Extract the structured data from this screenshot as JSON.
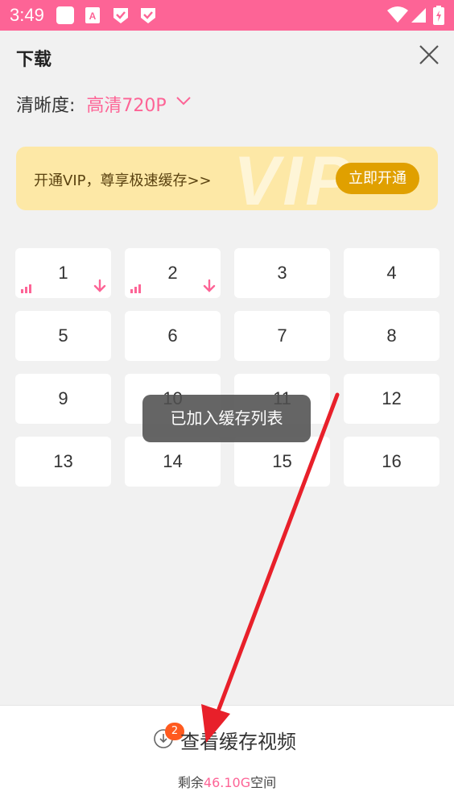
{
  "status_bar": {
    "time": "3:49",
    "left_icons": [
      "notification-square-icon",
      "app-a-icon",
      "shield-check-icon",
      "shield-check-icon"
    ],
    "right_icons": [
      "wifi-icon",
      "signal-icon",
      "battery-charging-icon"
    ],
    "color": "#fd6496"
  },
  "header": {
    "title": "下载",
    "close_icon": "close-icon"
  },
  "quality": {
    "label": "清晰度:",
    "value": "高清720P"
  },
  "vip_banner": {
    "text": "开通VIP，尊享极速缓存>>",
    "button_label": "立即开通",
    "watermark": "VIP"
  },
  "episodes": [
    {
      "label": "1",
      "queued": true
    },
    {
      "label": "2",
      "queued": true
    },
    {
      "label": "3",
      "queued": false
    },
    {
      "label": "4",
      "queued": false
    },
    {
      "label": "5",
      "queued": false
    },
    {
      "label": "6",
      "queued": false
    },
    {
      "label": "7",
      "queued": false
    },
    {
      "label": "8",
      "queued": false
    },
    {
      "label": "9",
      "queued": false
    },
    {
      "label": "10",
      "queued": false
    },
    {
      "label": "11",
      "queued": false
    },
    {
      "label": "12",
      "queued": false
    },
    {
      "label": "13",
      "queued": false
    },
    {
      "label": "14",
      "queued": false
    },
    {
      "label": "15",
      "queued": false
    },
    {
      "label": "16",
      "queued": false
    }
  ],
  "toast": "已加入缓存列表",
  "bottom": {
    "badge_count": "2",
    "view_label": "查看缓存视频",
    "space_prefix": "剩余",
    "space_amount": "46.10G",
    "space_suffix": "空间"
  },
  "colors": {
    "accent": "#fd6496",
    "vip_button": "#e0a000",
    "badge": "#ff5a1f",
    "annotation_arrow": "#e8202a"
  }
}
